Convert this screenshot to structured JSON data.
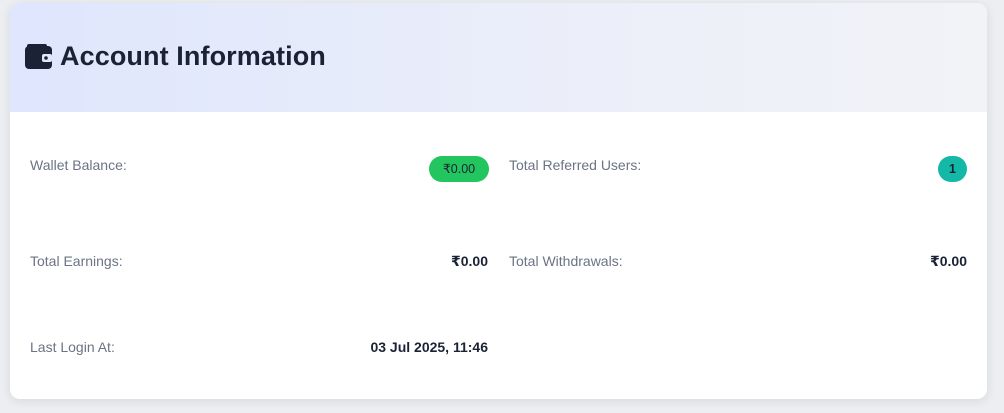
{
  "header": {
    "title": "Account Information",
    "icon": "wallet-icon"
  },
  "stats": {
    "wallet_balance": {
      "label": "Wallet Balance:",
      "value": "₹0.00"
    },
    "total_referred_users": {
      "label": "Total Referred Users:",
      "value": "1"
    },
    "total_earnings": {
      "label": "Total Earnings:",
      "value": "₹0.00"
    },
    "total_withdrawals": {
      "label": "Total Withdrawals:",
      "value": "₹0.00"
    },
    "last_login_at": {
      "label": "Last Login At:",
      "value": "03 Jul 2025, 11:46"
    }
  },
  "colors": {
    "balance_badge": "#22c55e",
    "referred_badge": "#14b8a6",
    "title_text": "#1b2235",
    "label_text": "#6b7385"
  }
}
